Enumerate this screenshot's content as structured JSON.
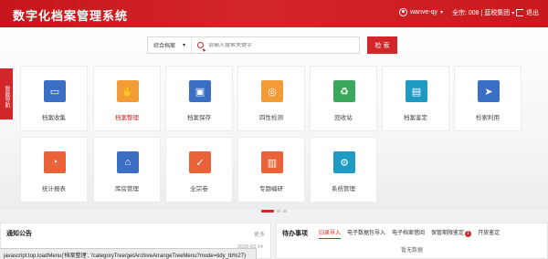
{
  "header": {
    "app_title": "数字化档案管理系统",
    "user_name": "wanve-qy",
    "dept_label": "全宗: 008 | 蓝税集团",
    "exit_label": "退出"
  },
  "search": {
    "scope_value": "综合档案",
    "placeholder": "请输入搜索关键字",
    "button_label": "检 索"
  },
  "side_nav": {
    "label": "智能导航"
  },
  "modules": [
    {
      "label": "档案收集",
      "icon": "inbox-icon",
      "color": "#3a6fc4"
    },
    {
      "label": "档案整理",
      "icon": "hand-document-icon",
      "color": "#f39b36"
    },
    {
      "label": "档案保存",
      "icon": "save-disk-icon",
      "color": "#3a6fc4"
    },
    {
      "label": "四性检测",
      "icon": "detect-target-icon",
      "color": "#f39b36"
    },
    {
      "label": "回收站",
      "icon": "recycle-bin-icon",
      "color": "#3aa85a"
    },
    {
      "label": "档案鉴定",
      "icon": "appraisal-chart-icon",
      "color": "#1f9ac2"
    },
    {
      "label": "检索利用",
      "icon": "send-arrow-icon",
      "color": "#3a6fc4"
    },
    {
      "label": "统计报表",
      "icon": "pie-chart-icon",
      "color": "#e9623a"
    },
    {
      "label": "库房管理",
      "icon": "warehouse-icon",
      "color": "#3a6fc4"
    },
    {
      "label": "全宗卷",
      "icon": "check-folder-icon",
      "color": "#e9623a"
    },
    {
      "label": "专题编研",
      "icon": "topic-document-icon",
      "color": "#e9623a"
    },
    {
      "label": "系统管理",
      "icon": "gear-icon",
      "color": "#1f9ac2"
    }
  ],
  "notice": {
    "title": "通知公告",
    "more": "更多",
    "date": "2020-03-14"
  },
  "todo": {
    "title": "待办事项",
    "tabs": [
      "归录导入",
      "电子数据包导入",
      "电子档案借阅",
      "保管期限鉴定",
      "开放鉴定"
    ],
    "badge": "1",
    "empty": "暂无数据"
  },
  "statusbar": "javascript:top.loadMenu('档案整理', '/categoryTree/getArchiveArrangeTreeMenu?mode=tidy_tb%27)"
}
